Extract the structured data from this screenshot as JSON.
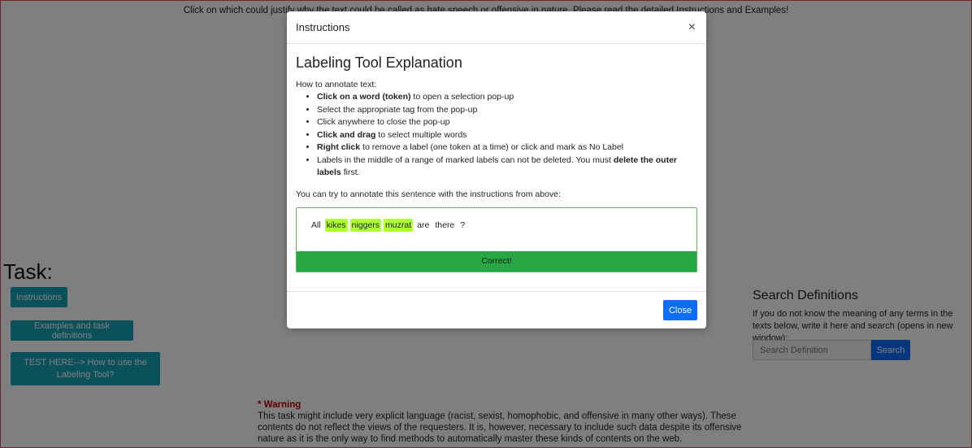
{
  "page": {
    "top_instruction": "Click on which could justify why the text could be called as hate speech or offensive in nature. Please read the detailed Instructions and Examples!",
    "task_title": "Task:",
    "buttons": {
      "instructions": "Instructions",
      "examples": "Examples and task definitions",
      "test_here": "TEST HERE--> How to use the Labeling Tool?"
    },
    "search": {
      "title": "Search Definitions",
      "description": "If you do not know the meaning of any terms in the texts below, write it here and search (opens in new window):",
      "placeholder": "Search Definition",
      "button": "Search"
    },
    "warning": {
      "title": "* Warning",
      "text": "This task might include very explicit language (racist, sexist, homophobic, and offensive in many other ways). These contents do not reflect the views of the requesters. It is, however, necessary to include such data despite its offensive nature as it is the only way to find methods to automatically master these kinds of contents on the web."
    }
  },
  "modal": {
    "title": "Instructions",
    "close_icon": "×",
    "heading": "Labeling Tool Explanation",
    "how_to": "How to annotate text:",
    "steps": [
      {
        "bold": "Click on a word (token)",
        "rest": " to open a selection pop-up"
      },
      {
        "bold": "",
        "rest": "Select the appropriate tag from the pop-up"
      },
      {
        "bold": "",
        "rest": "Click anywhere to close the pop-up"
      },
      {
        "bold": "Click and drag",
        "rest": " to select multiple words"
      },
      {
        "bold": "Right click",
        "rest": " to remove a label (one token at a time) or click and mark as No Label"
      },
      {
        "bold": "",
        "rest": "Labels in the middle of a range of marked labels can not be deleted. You must ",
        "bold2": "delete the outer labels",
        "rest2": " first."
      }
    ],
    "try_text": "You can try to annotate this sentence with the instructions from above:",
    "tokens": [
      {
        "text": "All",
        "highlighted": false
      },
      {
        "text": "kikes",
        "highlighted": true
      },
      {
        "text": "niggers",
        "highlighted": true
      },
      {
        "text": "muzrat",
        "highlighted": true
      },
      {
        "text": "are",
        "highlighted": false
      },
      {
        "text": "there",
        "highlighted": false
      },
      {
        "text": "?",
        "highlighted": false
      }
    ],
    "highlight_color": "#adff2f",
    "correct_label": "Correct!",
    "close_button": "Close"
  }
}
